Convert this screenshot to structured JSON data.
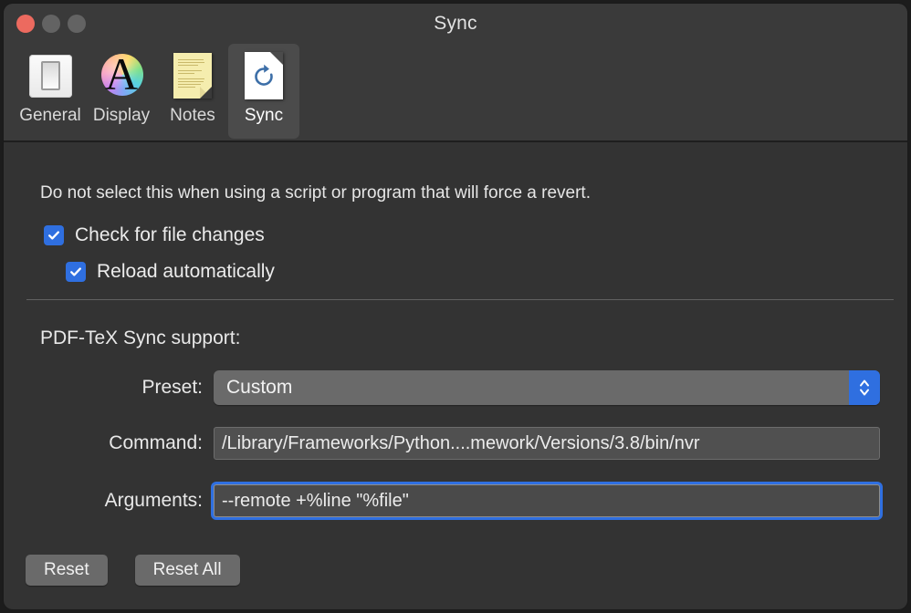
{
  "window": {
    "title": "Sync",
    "traffic_lights": [
      {
        "name": "close",
        "color": "#ec6a5f"
      },
      {
        "name": "minimize",
        "color": "#636363"
      },
      {
        "name": "zoom",
        "color": "#636363"
      }
    ]
  },
  "toolbar": {
    "items": [
      {
        "label": "General",
        "icon": "light-switch-icon",
        "selected": false
      },
      {
        "label": "Display",
        "icon": "rainbow-letter-a-icon",
        "selected": false
      },
      {
        "label": "Notes",
        "icon": "yellow-note-icon",
        "selected": false
      },
      {
        "label": "Sync",
        "icon": "document-refresh-icon",
        "selected": true
      }
    ]
  },
  "content": {
    "description": "Do not select this when using a script or program that will force a revert.",
    "checkboxes": [
      {
        "label": "Check for file changes",
        "checked": true
      },
      {
        "label": "Reload automatically",
        "checked": true
      }
    ],
    "section_title": "PDF-TeX Sync support:",
    "fields": [
      {
        "label": "Preset:",
        "type": "popup",
        "value": "Custom"
      },
      {
        "label": "Command:",
        "type": "text",
        "value": "/Library/Frameworks/Python....mework/Versions/3.8/bin/nvr",
        "focused": false
      },
      {
        "label": "Arguments:",
        "type": "text",
        "value": "--remote +%line \"%file\"",
        "focused": true
      }
    ],
    "buttons": [
      {
        "label": "Reset"
      },
      {
        "label": "Reset All"
      }
    ]
  },
  "colors": {
    "accent": "#2f6fe0",
    "window_bg": "#333333",
    "titlebar_bg": "#3a3a3a",
    "text": "#ececec"
  }
}
